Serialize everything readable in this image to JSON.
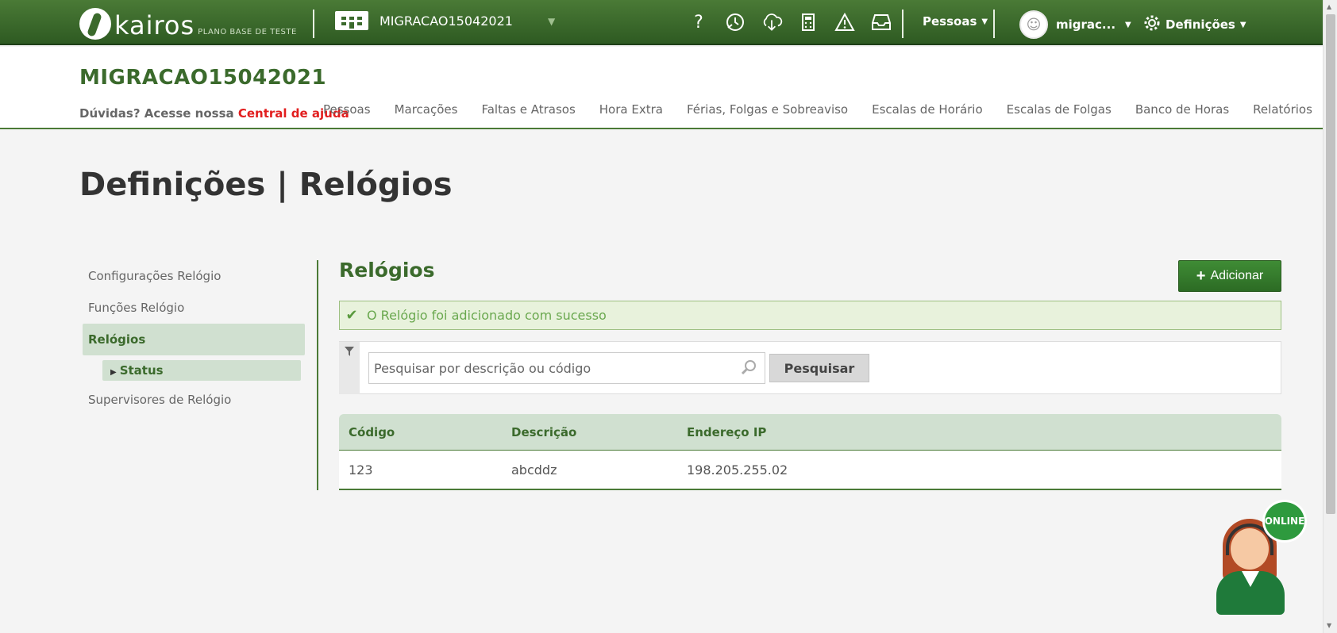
{
  "topbar": {
    "logo_text": "kairos",
    "logo_sub": "PLANO BASE DE TESTE",
    "company_name": "MIGRACAO15042021",
    "icons": [
      "help-icon",
      "punch-clock-icon",
      "cloud-download-icon",
      "calculator-icon",
      "warning-icon",
      "inbox-icon"
    ],
    "people_menu": "Pessoas",
    "user_menu": "migrac...",
    "settings_menu": "Definições"
  },
  "header": {
    "company_title": "MIGRACAO15042021",
    "help_prefix": "Dúvidas? Acesse nossa ",
    "help_link": "Central de ajuda",
    "nav": [
      "Pessoas",
      "Marcações",
      "Faltas e Atrasos",
      "Hora Extra",
      "Férias, Folgas e Sobreaviso",
      "Escalas de Horário",
      "Escalas de Folgas",
      "Banco de Horas",
      "Relatórios"
    ]
  },
  "page_title": "Definições | Relógios",
  "sidebar": {
    "items": [
      {
        "label": "Configurações Relógio"
      },
      {
        "label": "Funções Relógio"
      },
      {
        "label": "Relógios"
      },
      {
        "label": "Status"
      },
      {
        "label": "Supervisores de Relógio"
      }
    ]
  },
  "main": {
    "title": "Relógios",
    "add_button": "Adicionar",
    "alert": "O Relógio foi adicionado com sucesso",
    "search_placeholder": "Pesquisar por descrição ou código",
    "search_button": "Pesquisar",
    "table": {
      "headers": [
        "Código",
        "Descrição",
        "Endereço IP"
      ],
      "rows": [
        [
          "123",
          "abcddz",
          "198.205.255.02"
        ]
      ]
    }
  },
  "chat": {
    "badge": "ONLINE"
  },
  "colors": {
    "brand_green": "#3b6a2c",
    "topbar_green": "#4a7a36",
    "button_green": "#2c6b24",
    "help_link_red": "#e21e1e",
    "highlight_green": "#d0e0d0"
  }
}
